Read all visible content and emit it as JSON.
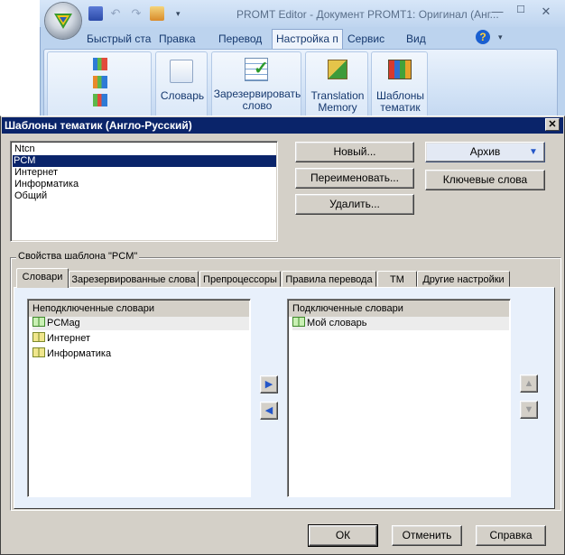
{
  "app": {
    "title": "PROMT Editor - Документ PROMT1: Оригинал (Анг...",
    "tabs": [
      "Быстрый ста",
      "Правка",
      "Перевод",
      "Настройка п",
      "Сервис",
      "Вид"
    ],
    "active_tab": "Настройка п",
    "ribbon_buttons": [
      {
        "label": "Словарь",
        "label2": ""
      },
      {
        "label": "Зарезервировать",
        "label2": "слово"
      },
      {
        "label": "Translation",
        "label2": "Memory"
      },
      {
        "label": "Шаблоны",
        "label2": "тематик"
      }
    ],
    "help_glyph": "?"
  },
  "dialog": {
    "title": "Шаблоны тематик (Англо-Русский)",
    "close_glyph": "✕",
    "templates": [
      "Ntcn",
      "PCM",
      "Интернет",
      "Информатика",
      "Общий"
    ],
    "selected_template": "PCM",
    "buttons": {
      "new": "Новый...",
      "rename": "Переименовать...",
      "delete": "Удалить...",
      "archive": "Архив",
      "keywords": "Ключевые слова",
      "ok": "ОК",
      "cancel": "Отменить",
      "help": "Справка"
    },
    "properties_label": "Свойства шаблона \"PCM\"",
    "tabs": [
      "Словари",
      "Зарезервированные слова",
      "Препроцессоры",
      "Правила перевода",
      "ТМ",
      "Другие настройки"
    ],
    "active_tab": "Словари",
    "unconnected": {
      "header": "Неподключенные словари",
      "items": [
        "PCMag",
        "Интернет",
        "Информатика"
      ]
    },
    "connected": {
      "header": "Подключенные словари",
      "items": [
        "Мой словарь"
      ]
    },
    "arrows": {
      "right": "▶",
      "left": "◀",
      "up": "▲",
      "down": "▼"
    }
  },
  "colors": {
    "selection": "#0a246a",
    "dialog_face": "#d4d0c8",
    "tab_panel": "#e8f0fb",
    "ribbon_text": "#15386e"
  }
}
